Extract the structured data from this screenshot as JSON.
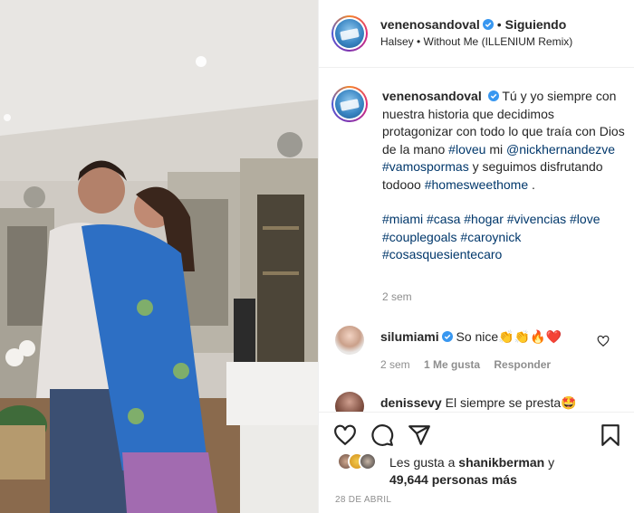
{
  "post": {
    "username": "venenosandoval",
    "follow_status": "Siguiendo",
    "separator": "•",
    "music": "Halsey • Without Me (ILLENIUM Remix)"
  },
  "caption": {
    "username": "venenosandoval",
    "text_1": "Tú y yo siempre con nuestra historia que decidimos protagonizar con todo lo que traía con Dios de la mano",
    "tag_loveu": "#loveu",
    "text_2": "mi",
    "mention": "@nickhernandezve",
    "tag_vamos": "#vamospormas",
    "text_3": "y seguimos disfrutando todooo",
    "tag_home": "#homesweethome",
    "text_4": ".",
    "tags": [
      "#miami",
      "#casa",
      "#hogar",
      "#vivencias",
      "#love",
      "#couplegoals",
      "#caroynick",
      "#cosasquesientecaro"
    ],
    "time": "2 sem"
  },
  "comments": [
    {
      "username": "silumiami",
      "text": "So nice👏👏🔥❤️",
      "time": "2 sem",
      "likes": "1 Me gusta",
      "reply": "Responder"
    },
    {
      "username": "denissevy",
      "text": "El siempre se presta🤩"
    }
  ],
  "likes": {
    "prefix": "Les gusta a",
    "liker": "shanikberman",
    "suffix": "y",
    "count": "49,644",
    "count_suffix": "personas más"
  },
  "date": "28 DE ABRIL",
  "icons": [
    "verified-icon",
    "heart-icon",
    "comment-icon",
    "share-icon",
    "bookmark-icon"
  ],
  "colors": {
    "verified": "#3897f0",
    "link": "#00376b",
    "muted": "#8e8e8e",
    "border": "#efefef"
  }
}
